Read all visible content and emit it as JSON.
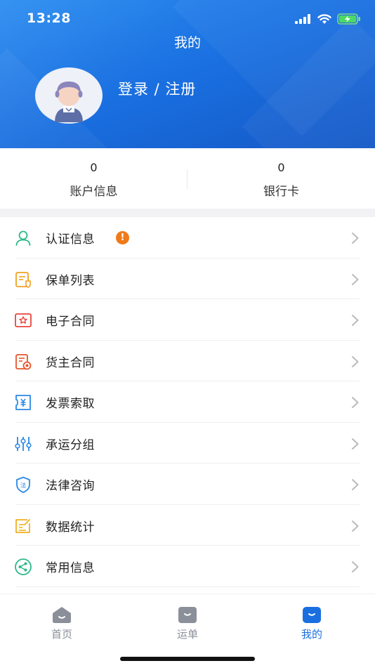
{
  "status_bar": {
    "time": "13:28"
  },
  "header": {
    "title": "我的",
    "login_text": "登录 / 注册"
  },
  "stats": [
    {
      "value": "0",
      "label": "账户信息"
    },
    {
      "value": "0",
      "label": "银行卡"
    }
  ],
  "menu": {
    "items": [
      {
        "label": "认证信息",
        "icon": "user-verify-icon",
        "color": "#2bb98a",
        "badge": "!"
      },
      {
        "label": "保单列表",
        "icon": "policy-list-icon",
        "color": "#f0a020"
      },
      {
        "label": "电子合同",
        "icon": "e-contract-icon",
        "color": "#e8453c"
      },
      {
        "label": "货主合同",
        "icon": "shipper-contract-icon",
        "color": "#e8552c"
      },
      {
        "label": "发票索取",
        "icon": "invoice-icon",
        "color": "#2a88e8"
      },
      {
        "label": "承运分组",
        "icon": "carrier-group-icon",
        "color": "#2a88e8"
      },
      {
        "label": "法律咨询",
        "icon": "legal-shield-icon",
        "color": "#2a88e8"
      },
      {
        "label": "数据统计",
        "icon": "data-stats-icon",
        "color": "#f0b020"
      },
      {
        "label": "常用信息",
        "icon": "share-icon",
        "color": "#2bb98a"
      }
    ]
  },
  "tabbar": {
    "tabs": [
      {
        "label": "首页",
        "icon": "home-icon"
      },
      {
        "label": "运单",
        "icon": "waybill-icon"
      },
      {
        "label": "我的",
        "icon": "profile-icon",
        "active": true
      }
    ]
  },
  "colors": {
    "primary": "#1a6fe0",
    "badge": "#f07a1a",
    "tab_inactive": "#8a8f99"
  }
}
